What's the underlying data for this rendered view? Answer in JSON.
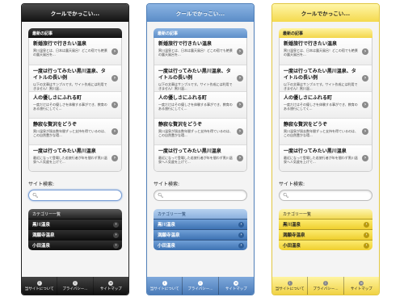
{
  "app": {
    "title": "クールでかっこい..."
  },
  "articles": {
    "header": "最新の記事",
    "items": [
      {
        "title": "新婚旅行で行きたい温泉",
        "desc": "黒川温泉とは、日本は露天風呂！どこの宿でも絶景の露天風呂を..."
      },
      {
        "title": "一度は行ってみたい黒川温泉、タイトルの長い例",
        "desc": "以下の文章はサンプルです。サイト作成には利用できません！黒川温..."
      },
      {
        "title": "人の優しさにふれる町",
        "desc": "一度だけはその優しさを体験する事ができ、教育のある旅行にしてく..."
      },
      {
        "title": "静寂な贅沢をどうぞ",
        "desc": "黒川温泉が過去数年間ずっと支持を得ているのは、この自然豊かな環..."
      },
      {
        "title": "一度は行ってみたい黒川温泉",
        "desc": "最近になって登場した若旅行者が年を間わず黒川温泉へ人気度を上げて..."
      }
    ]
  },
  "search": {
    "label": "サイト検索:",
    "placeholder": ""
  },
  "categories": {
    "header": "カテゴリー一覧",
    "items": [
      "黒川温泉",
      "満願寺温泉",
      "小田温泉"
    ]
  },
  "footer": {
    "items": [
      {
        "label": "当サイトについて",
        "icon": "info-icon"
      },
      {
        "label": "プライバシー...",
        "icon": "info-icon"
      },
      {
        "label": "サイトマップ",
        "icon": "sitemap-icon"
      }
    ]
  },
  "themes": {
    "black": "#111111",
    "blue": "#5a8cc7",
    "yellow": "#f4d94e"
  }
}
